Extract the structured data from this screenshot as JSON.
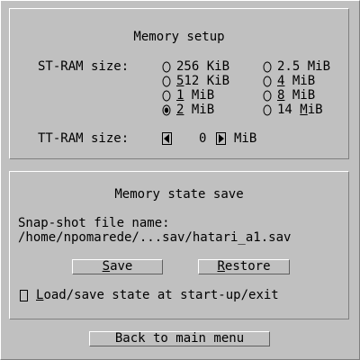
{
  "memory_setup": {
    "title": "Memory setup",
    "st_ram_label": "ST-RAM size:",
    "st_ram_options": [
      {
        "label": "256 KiB",
        "hotkey": "",
        "selected": false
      },
      {
        "label": "512 KiB",
        "hotkey": "5",
        "selected": false
      },
      {
        "label": "1 MiB",
        "hotkey": "1",
        "selected": false
      },
      {
        "label": "2 MiB",
        "hotkey": "2",
        "selected": true
      },
      {
        "label": "2.5 MiB",
        "hotkey": "",
        "selected": false
      },
      {
        "label": "4 MiB",
        "hotkey": "4",
        "selected": false
      },
      {
        "label": "8 MiB",
        "hotkey": "8",
        "selected": false
      },
      {
        "label": "14 MiB",
        "hotkey": "M",
        "selected": false
      }
    ],
    "tt_ram_label": "TT-RAM size:",
    "tt_ram_value": "0",
    "tt_ram_unit": "MiB"
  },
  "state_save": {
    "title": "Memory state save",
    "file_label": "Snap-shot file name:",
    "file_path": "/home/npomarede/...sav/hatari_a1.sav",
    "save_label": "Save",
    "restore_label": "Restore",
    "autoload_label": "Load/save state at start-up/exit",
    "autoload_checked": false
  },
  "back_label": "Back to main menu"
}
